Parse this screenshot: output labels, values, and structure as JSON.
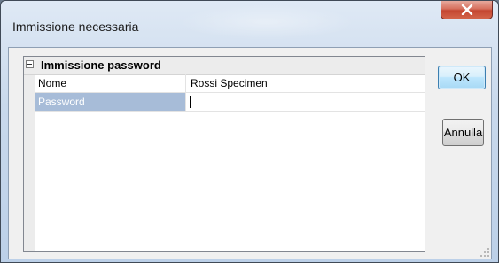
{
  "window": {
    "title": "Immissione necessaria"
  },
  "property_grid": {
    "category": "Immissione password",
    "rows": [
      {
        "name": "Nome",
        "value": "Rossi Specimen"
      },
      {
        "name": "Password",
        "value": ""
      }
    ]
  },
  "buttons": {
    "ok_label": "OK",
    "cancel_label": "Annulla"
  },
  "colors": {
    "selection": "#a7bcd8",
    "close_button": "#c44631"
  }
}
